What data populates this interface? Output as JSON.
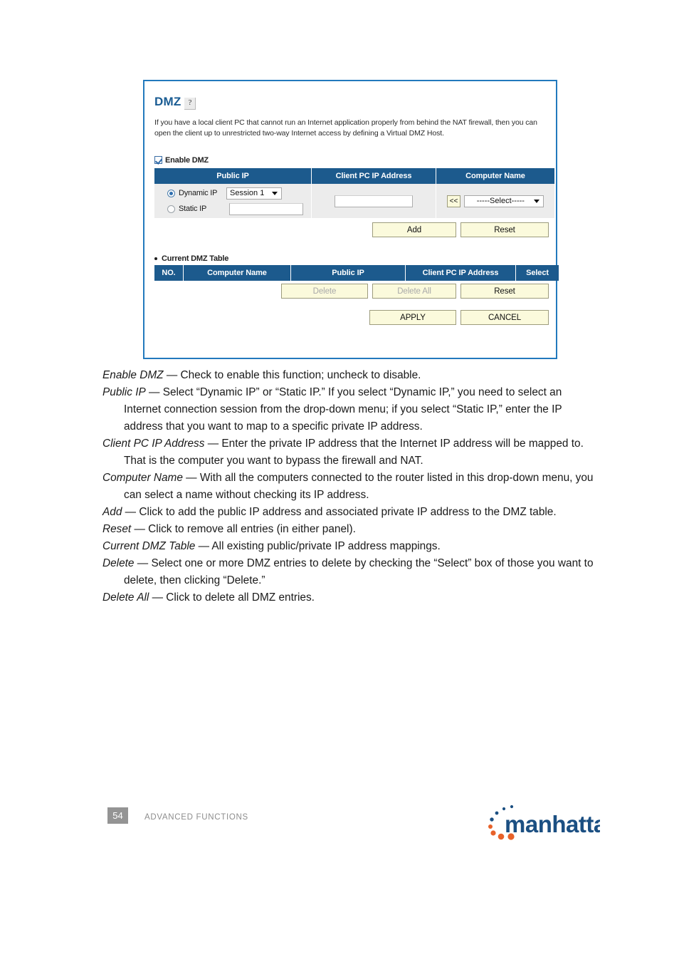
{
  "screenshot_panel": {
    "title": "DMZ",
    "help_icon": "question-mark-help-icon",
    "description": "If you have a local client PC that cannot run an Internet application properly from behind the NAT firewall, then you can open the client up to unrestricted two-way Internet access by defining a Virtual DMZ Host.",
    "enable_checkbox": {
      "label": "Enable DMZ",
      "checked": true
    },
    "form_table": {
      "headers": [
        "Public IP",
        "Client PC IP Address",
        "Computer Name"
      ],
      "public_ip": {
        "dynamic_label": "Dynamic IP",
        "dynamic_selected": true,
        "session_select_value": "Session 1",
        "static_label": "Static IP",
        "static_selected": false,
        "static_input_value": ""
      },
      "client_pc_ip_value": "",
      "computer_name": {
        "copy_button_label": "<<",
        "select_value": "-----Select-----"
      }
    },
    "form_buttons": {
      "add": "Add",
      "reset": "Reset"
    },
    "current_table": {
      "label": "Current DMZ Table",
      "headers": [
        "NO.",
        "Computer Name",
        "Public IP",
        "Client PC IP Address",
        "Select"
      ],
      "rows": []
    },
    "table_buttons": {
      "delete": "Delete",
      "delete_disabled": true,
      "delete_all": "Delete All",
      "delete_all_disabled": true,
      "reset": "Reset",
      "reset_disabled": false
    },
    "footer_buttons": {
      "apply": "APPLY",
      "cancel": "CANCEL"
    },
    "colors": {
      "panel_border": "#2279bd",
      "table_header": "#1c5a8d",
      "title_blue": "#1a5c93",
      "button_cream": "#fbfadc",
      "field_bg": "#ececec"
    }
  },
  "body_copy": {
    "paragraphs": [
      {
        "term": "Enable DMZ",
        "text": " — Check to enable this function; uncheck to disable."
      },
      {
        "term": "Public IP",
        "text": " — Select “Dynamic IP” or “Static IP.” If you select “Dynamic IP,” you need to select an Internet connection session from the drop-down menu; if you select “Static IP,” enter the IP address that you want to map to a specific private IP address."
      },
      {
        "term": "Client PC IP Address",
        "text": " — Enter the private IP address that the Internet IP address will be mapped to. That is the computer you want to bypass the firewall and NAT."
      },
      {
        "term": " Computer Name",
        "text": " — With all the computers connected to the router listed in this drop-down menu, you can select a name without checking its IP address."
      },
      {
        "term": "Add",
        "text": " — Click to add the public IP address and associated private IP address to the DMZ table."
      },
      {
        "term": "Reset",
        "text": " — Click to remove all entries (in either panel)."
      },
      {
        "term": "Current DMZ Table",
        "text": " — All existing public/private IP address mappings."
      },
      {
        "term": "Delete",
        "text": " — Select one or more DMZ entries to delete by checking the “Select” box of those you want to delete, then clicking “Delete.”"
      },
      {
        "term": "Delete All",
        "text": " — Click to delete all DMZ entries."
      }
    ]
  },
  "page_footer": {
    "page_number": "54",
    "section": "ADVANCED FUNCTIONS",
    "logo_text": "manhattan",
    "logo_text_color": "#1b4f82",
    "logo_dot_color": "#e8622a"
  }
}
